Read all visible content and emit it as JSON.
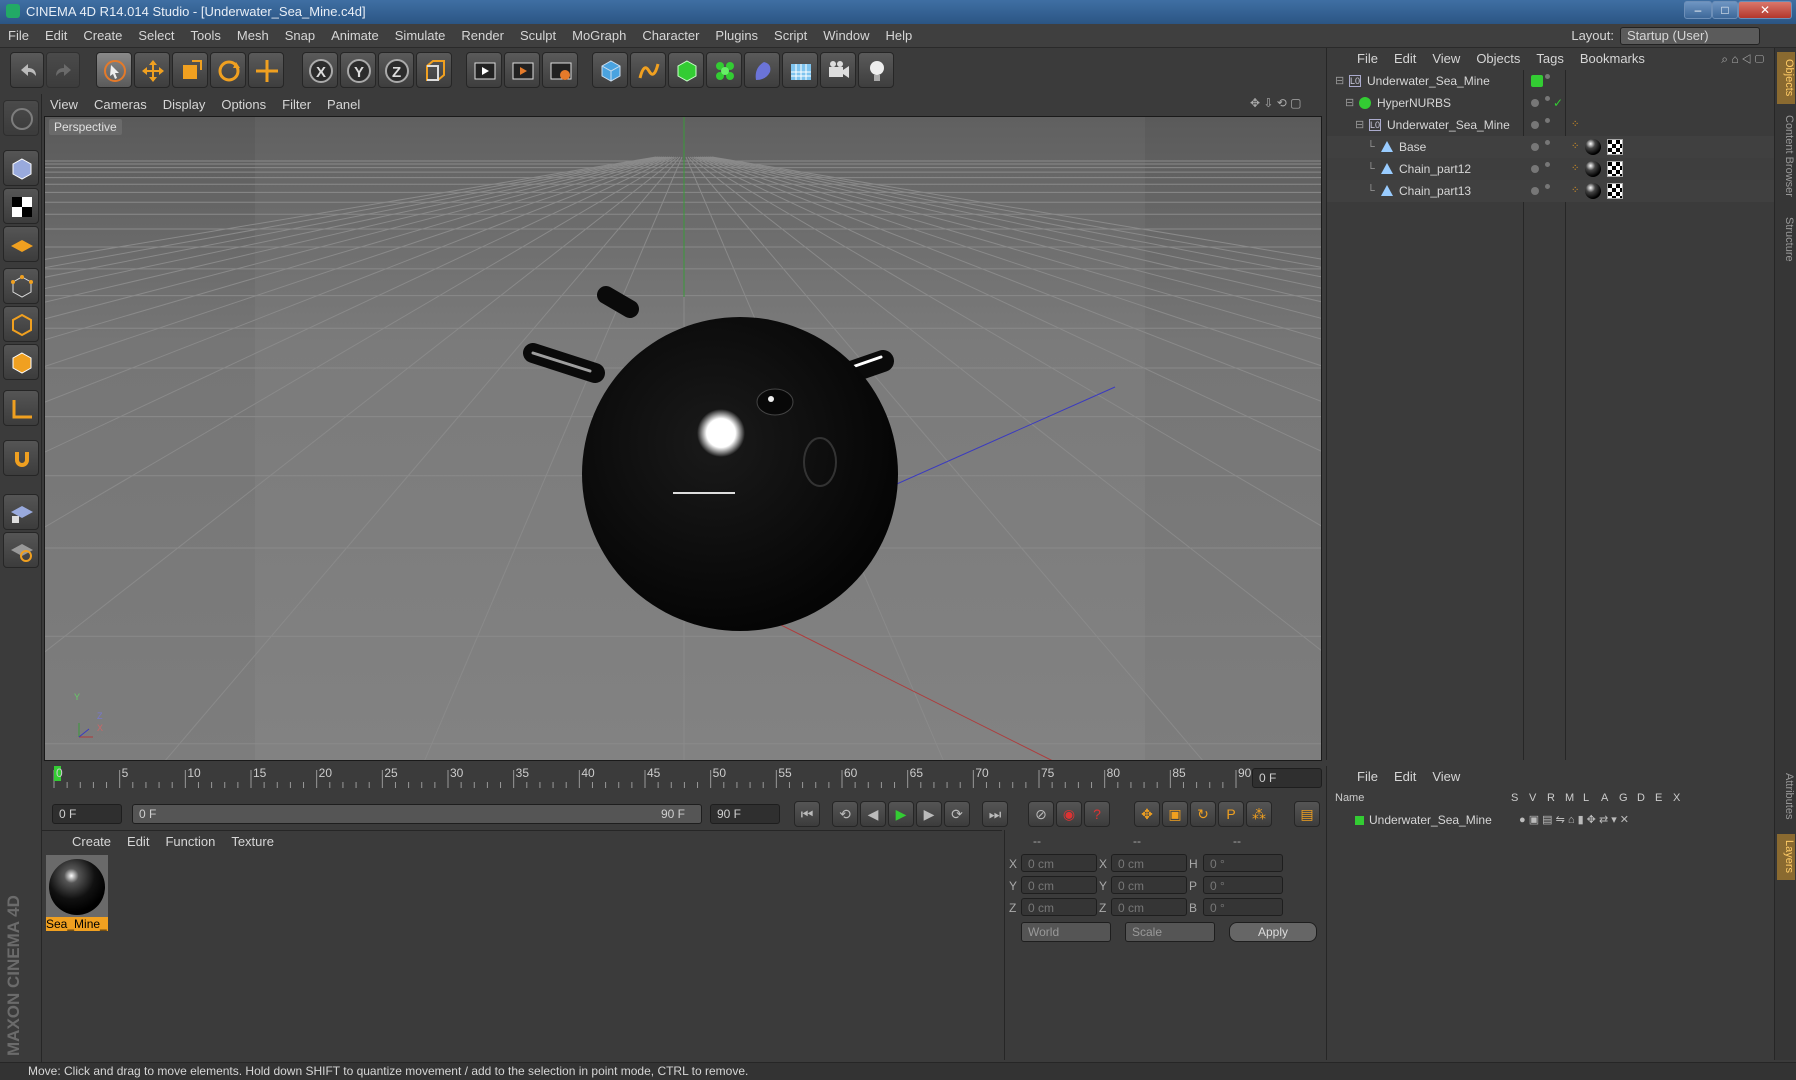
{
  "title": "CINEMA 4D R14.014 Studio - [Underwater_Sea_Mine.c4d]",
  "menubar": [
    "File",
    "Edit",
    "Create",
    "Select",
    "Tools",
    "Mesh",
    "Snap",
    "Animate",
    "Simulate",
    "Render",
    "Sculpt",
    "MoGraph",
    "Character",
    "Plugins",
    "Script",
    "Window",
    "Help"
  ],
  "layout": {
    "label": "Layout:",
    "value": "Startup (User)"
  },
  "viewport": {
    "menu": [
      "View",
      "Cameras",
      "Display",
      "Options",
      "Filter",
      "Panel"
    ],
    "label": "Perspective",
    "axis_y": "Y",
    "axis_z": "Z",
    "axis_x": "X"
  },
  "timeline": {
    "ticks": [
      "0",
      "5",
      "10",
      "15",
      "20",
      "25",
      "30",
      "35",
      "40",
      "45",
      "50",
      "55",
      "60",
      "65",
      "70",
      "75",
      "80",
      "85",
      "90"
    ],
    "current": "0 F"
  },
  "transport": {
    "start": "0 F",
    "range_left": "0 F",
    "range_right": "90 F",
    "end": "90 F"
  },
  "materials": {
    "menu": [
      "Create",
      "Edit",
      "Function",
      "Texture"
    ],
    "items": [
      {
        "name": "Sea_Mine_"
      }
    ]
  },
  "coords": {
    "headers": [
      "--",
      "--",
      "--"
    ],
    "rows": [
      {
        "a": "X",
        "av": "0 cm",
        "b": "X",
        "bv": "0 cm",
        "c": "H",
        "cv": "0 °"
      },
      {
        "a": "Y",
        "av": "0 cm",
        "b": "Y",
        "bv": "0 cm",
        "c": "P",
        "cv": "0 °"
      },
      {
        "a": "Z",
        "av": "0 cm",
        "b": "Z",
        "bv": "0 cm",
        "c": "B",
        "cv": "0 °"
      }
    ],
    "world": "World",
    "scale": "Scale",
    "apply": "Apply"
  },
  "objects": {
    "menu": [
      "File",
      "Edit",
      "View",
      "Objects",
      "Tags",
      "Bookmarks"
    ],
    "tree": [
      {
        "name": "Underwater_Sea_Mine"
      },
      {
        "name": "HyperNURBS"
      },
      {
        "name": "Underwater_Sea_Mine"
      },
      {
        "name": "Base"
      },
      {
        "name": "Chain_part12"
      },
      {
        "name": "Chain_part13"
      }
    ]
  },
  "layers": {
    "menu": [
      "File",
      "Edit",
      "View"
    ],
    "columns": [
      "Name",
      "S",
      "V",
      "R",
      "M",
      "L",
      "A",
      "G",
      "D",
      "E",
      "X"
    ],
    "row": "Underwater_Sea_Mine"
  },
  "right_tabs": [
    "Objects",
    "Content Browser",
    "Structure",
    "Attributes",
    "Layers"
  ],
  "brand": "MAXON CINEMA 4D",
  "status": "Move: Click and drag to move elements. Hold down SHIFT to quantize movement / add to the selection in point mode, CTRL to remove.",
  "colors": {
    "title": "#2b5584",
    "panel": "#3b3b3b",
    "accent": "#f0a020",
    "green": "#3c3"
  }
}
